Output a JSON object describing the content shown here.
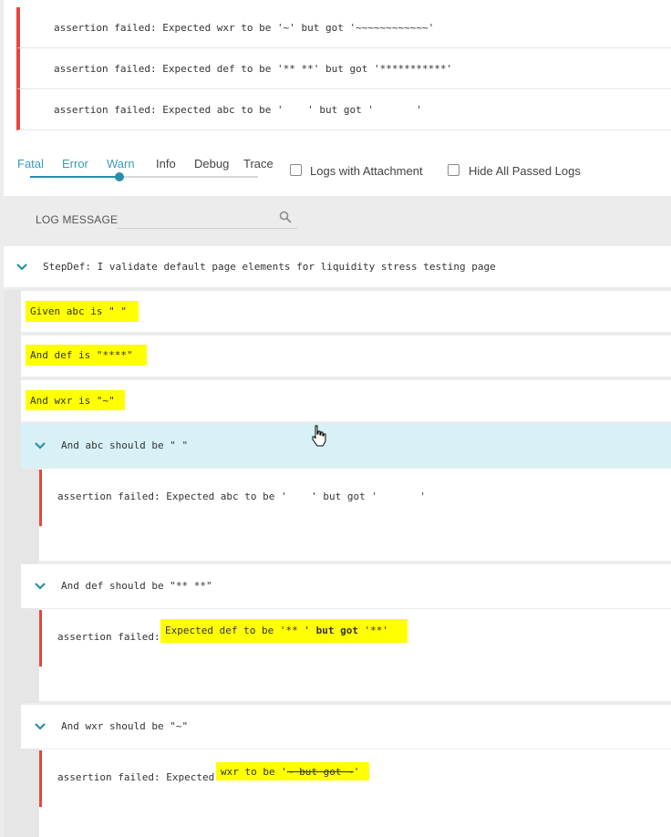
{
  "top_failures": [
    "assertion failed: Expected wxr to be '~' but got '~~~~~~~~~~~~'",
    "assertion failed: Expected def to be '** **' but got '***********'",
    "assertion failed: Expected abc to be '    ' but got '       '"
  ],
  "filters": {
    "levels": [
      "Fatal",
      "Error",
      "Warn",
      "Info",
      "Debug",
      "Trace"
    ],
    "selected_level": "Warn",
    "logs_with_attachment": "Logs with Attachment",
    "hide_all_passed": "Hide All Passed Logs"
  },
  "log_message": {
    "label": "LOG MESSAGE",
    "placeholder": ""
  },
  "stepdef": {
    "title": "StepDef: I validate default page elements for liquidity stress testing page",
    "steps": [
      "Given abc is \" \"",
      "And def is \"****\"",
      "And wxr is \"~\""
    ],
    "assertions": [
      {
        "title": "And abc should be \" \"",
        "message": "assertion failed: Expected abc to be '    ' but got '       '"
      },
      {
        "title": "And def should be \"** **\"",
        "prefix": "assertion failed: ",
        "hl_part1": "Expected def to be '** ' ",
        "hl_bold": "but got",
        "hl_part2": " '**'"
      },
      {
        "title": "And wxr should be \"~\"",
        "prefix": "assertion failed: Expected ",
        "hl_part1": "wxr to be '",
        "hl_strike": "~ but got ~",
        "hl_part2": "'"
      }
    ]
  },
  "colors": {
    "accent": "#2a8fa8",
    "error_bar": "#e8453c",
    "highlight": "#ffff00",
    "active_row": "#d7f1f6"
  }
}
